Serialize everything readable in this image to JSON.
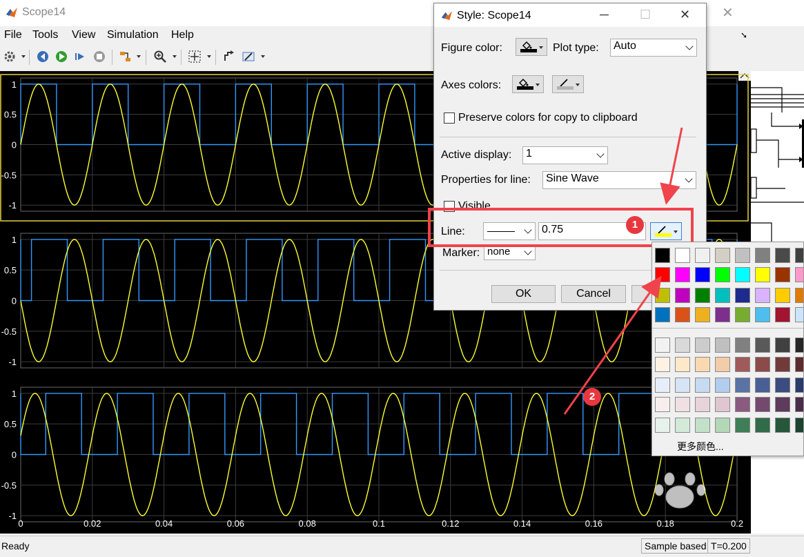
{
  "window": {
    "title": "Scope14",
    "menus": [
      "File",
      "Tools",
      "View",
      "Simulation",
      "Help"
    ]
  },
  "plots": {
    "y_ticks": [
      "1",
      "0.5",
      "0",
      "-0.5",
      "-1"
    ],
    "x_ticks": [
      "0",
      "0.02",
      "0.04",
      "0.06",
      "0.08",
      "0.1",
      "0.12",
      "0.14",
      "0.16",
      "0.18",
      "0.2"
    ]
  },
  "status": {
    "ready": "Ready",
    "sample_mode": "Sample based",
    "time": "T=0.200"
  },
  "dialog": {
    "title": "Style: Scope14",
    "figure_color_label": "Figure color:",
    "plot_type_label": "Plot type:",
    "plot_type_value": "Auto",
    "axes_colors_label": "Axes colors:",
    "preserve_label": "Preserve colors for copy to clipboard",
    "active_display_label": "Active display:",
    "active_display_value": "1",
    "properties_label": "Properties for line:",
    "properties_value": "Sine Wave",
    "visible_label": "Visible",
    "line_label": "Line:",
    "line_width_value": "0.75",
    "marker_label": "Marker:",
    "marker_value": "none",
    "ok_label": "OK",
    "cancel_label": "Cancel"
  },
  "annotations": {
    "badge1": "1",
    "badge2": "2"
  },
  "palette": {
    "more_colors_label": "更多颜色...",
    "rows": [
      [
        "#000000",
        "#ffffff",
        "#f0f0f0",
        "#d4cfc4",
        "#c0c0c0",
        "#808080",
        "#4a4a4a",
        "#404040"
      ],
      [
        "#ff0000",
        "#ff00ff",
        "#0000ff",
        "#00ff00",
        "#00ffff",
        "#ffff00",
        "#993300",
        "#ff99cc"
      ],
      [
        "#bfbf00",
        "#bf00bf",
        "#008000",
        "#00bfbf",
        "#1c2b8c",
        "#d9b3ff",
        "#ffcc00",
        "#e07b00"
      ],
      [
        "#0072bd",
        "#d95319",
        "#edb120",
        "#7e2f8e",
        "#77ac30",
        "#4dbeee",
        "#a2142f",
        "#cce5ff"
      ],
      [
        "#f2f2f2",
        "#d9d9d9",
        "#cccccc",
        "#bfbfbf",
        "#808080",
        "#595959",
        "#404040",
        "#262626"
      ],
      [
        "#fdf2e3",
        "#fde9c9",
        "#fad9b0",
        "#f3ccaa",
        "#a05a5a",
        "#8c4a4a",
        "#733a3a",
        "#5c2c2c"
      ],
      [
        "#e6eef9",
        "#d6e4f5",
        "#c7daf1",
        "#b3cdee",
        "#5a73a5",
        "#4a5f95",
        "#3a4c80",
        "#2a3a6a"
      ],
      [
        "#f7eeee",
        "#f0e0e4",
        "#e8d3da",
        "#dfc6d0",
        "#8a5a80",
        "#73496e",
        "#5e3a5c",
        "#4a2c4a"
      ],
      [
        "#e6f2ea",
        "#d4ead9",
        "#c3e1c9",
        "#b2d8b8",
        "#3f7f58",
        "#326b49",
        "#26573b",
        "#1b432d"
      ]
    ]
  },
  "colors": {
    "sine": "#ffff33",
    "square": "#3399ff",
    "highlight": "#f0434b"
  }
}
